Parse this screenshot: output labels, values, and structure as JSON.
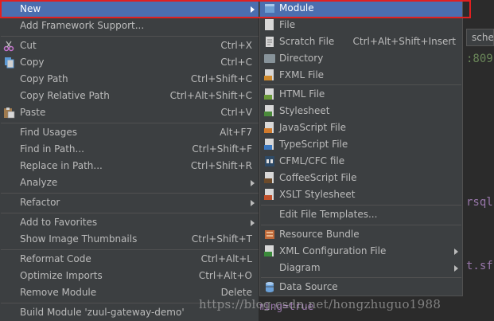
{
  "editor": {
    "tab_text": "sche",
    "code_port": ":809",
    "code_rsql": "rsql:",
    "code_tsf": "t.sf",
    "code_bottom": "ve.jdbc.sql.ming=true"
  },
  "watermark": "https://blog.csdn.net/hongzhuguo1988",
  "context_menu": {
    "items": [
      {
        "label": "New",
        "has_submenu": true,
        "highlighted": true
      },
      {
        "label": "Add Framework Support..."
      },
      {
        "label": "Cut",
        "shortcut": "Ctrl+X",
        "icon": "scissors-icon"
      },
      {
        "label": "Copy",
        "shortcut": "Ctrl+C",
        "icon": "copy-icon"
      },
      {
        "label": "Copy Path",
        "shortcut": "Ctrl+Shift+C"
      },
      {
        "label": "Copy Relative Path",
        "shortcut": "Ctrl+Alt+Shift+C"
      },
      {
        "label": "Paste",
        "shortcut": "Ctrl+V",
        "icon": "paste-icon"
      },
      {
        "label": "Find Usages",
        "shortcut": "Alt+F7"
      },
      {
        "label": "Find in Path...",
        "shortcut": "Ctrl+Shift+F"
      },
      {
        "label": "Replace in Path...",
        "shortcut": "Ctrl+Shift+R"
      },
      {
        "label": "Analyze",
        "has_submenu": true
      },
      {
        "label": "Refactor",
        "has_submenu": true
      },
      {
        "label": "Add to Favorites",
        "has_submenu": true
      },
      {
        "label": "Show Image Thumbnails",
        "shortcut": "Ctrl+Shift+T"
      },
      {
        "label": "Reformat Code",
        "shortcut": "Ctrl+Alt+L"
      },
      {
        "label": "Optimize Imports",
        "shortcut": "Ctrl+Alt+O"
      },
      {
        "label": "Remove Module",
        "shortcut": "Delete"
      },
      {
        "label": "Build Module 'zuul-gateway-demo'"
      }
    ]
  },
  "new_submenu": {
    "items": [
      {
        "label": "Module",
        "icon": "module-icon",
        "highlighted": true
      },
      {
        "label": "File",
        "icon": "file-icon"
      },
      {
        "label": "Scratch File",
        "shortcut": "Ctrl+Alt+Shift+Insert",
        "icon": "scratch-file-icon"
      },
      {
        "label": "Directory",
        "icon": "folder-icon"
      },
      {
        "label": "FXML File",
        "icon": "fxml-file-icon"
      },
      {
        "label": "HTML File",
        "icon": "html-file-icon"
      },
      {
        "label": "Stylesheet",
        "icon": "css-file-icon"
      },
      {
        "label": "JavaScript File",
        "icon": "javascript-file-icon"
      },
      {
        "label": "TypeScript File",
        "icon": "typescript-file-icon"
      },
      {
        "label": "CFML/CFC file",
        "icon": "cfml-file-icon"
      },
      {
        "label": "CoffeeScript File",
        "icon": "coffeescript-file-icon"
      },
      {
        "label": "XSLT Stylesheet",
        "icon": "xslt-file-icon"
      },
      {
        "label": "Edit File Templates..."
      },
      {
        "label": "Resource Bundle",
        "icon": "resource-bundle-icon"
      },
      {
        "label": "XML Configuration File",
        "icon": "xml-file-icon",
        "has_submenu": true
      },
      {
        "label": "Diagram",
        "has_submenu": true
      },
      {
        "label": "Data Source",
        "icon": "database-icon"
      }
    ]
  },
  "colors": {
    "menu_bg": "#3c3f41",
    "highlight": "#4b6eaf",
    "text": "#bbbbbb",
    "annotation_box": "#e02020"
  }
}
